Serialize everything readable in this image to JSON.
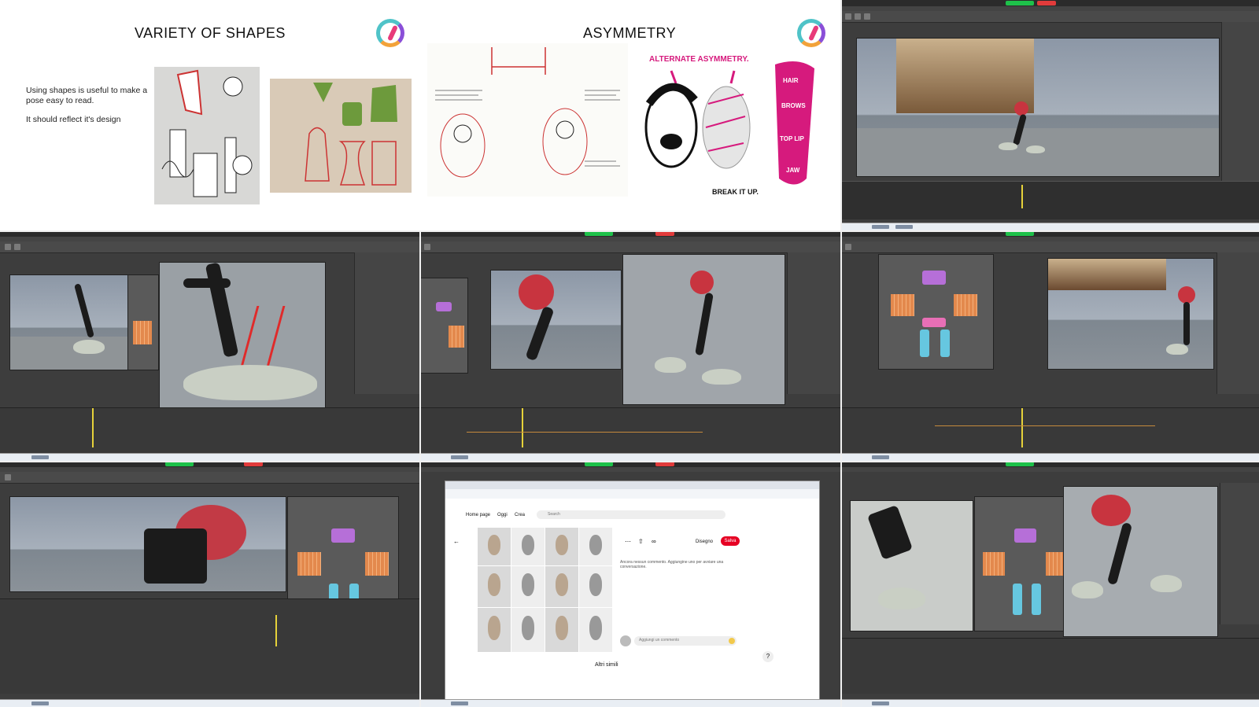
{
  "slides": {
    "left": {
      "title": "VARIETY OF SHAPES",
      "paragraph_1": "Using shapes is useful to make a pose easy to read.",
      "paragraph_2": "It should reflect it's design"
    },
    "right": {
      "title": "ASYMMETRY",
      "sketch_heading": "ALTERNATE ASYMMETRY.",
      "sketch_labels": [
        "HAIR",
        "BROWS",
        "TOP LIP",
        "JAW"
      ],
      "sketch_footer": "BREAK IT UP."
    }
  },
  "pinterest": {
    "nav_home": "Home page",
    "nav_today": "Oggi",
    "nav_create": "Crea",
    "search_placeholder": "Search",
    "board_select": "Disegno",
    "save_label": "Salva",
    "comment_placeholder": "Aggiungi un commento",
    "no_comments_text": "Ancora nessun commento. Aggiungine uno per avviare una conversazione.",
    "more_like_this": "Altri simili",
    "help": "?"
  },
  "colors": {
    "maya_bg": "#3d3d3d",
    "pinterest_red": "#e60023",
    "picker_purple": "#b66fd8",
    "picker_orange": "#e3894d",
    "picker_cyan": "#66c7e0",
    "recording_green": "#1ec14a",
    "recording_red": "#e23b3b",
    "sketch_magenta": "#d61a7d"
  },
  "icons": [
    "app-logo-icon",
    "search-icon",
    "share-icon",
    "link-icon",
    "more-icon",
    "back-arrow-icon",
    "emoji-icon"
  ]
}
